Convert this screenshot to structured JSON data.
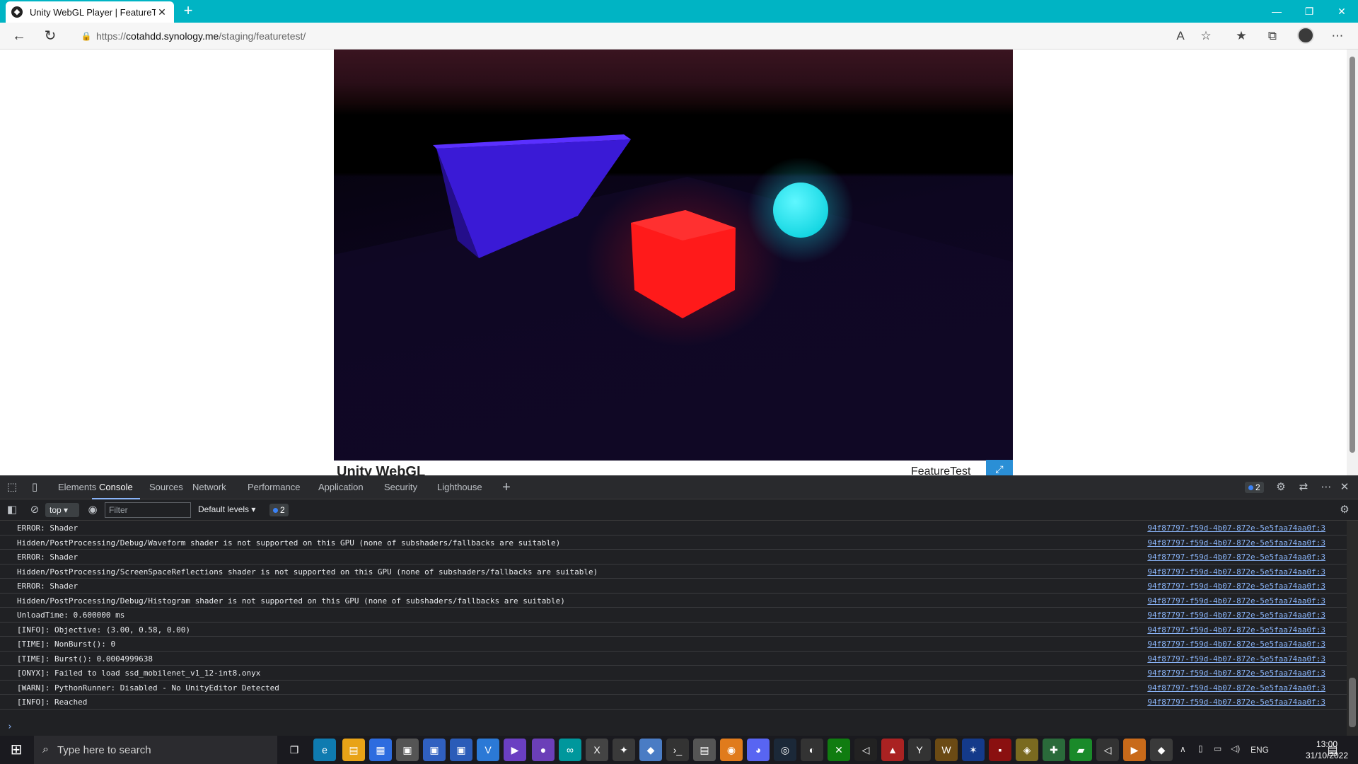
{
  "browser": {
    "tab_title": "Unity WebGL Player | FeatureTest",
    "url_scheme": "https://",
    "url_host": "cotahdd.synology.me",
    "url_path": "/staging/featuretest/"
  },
  "page": {
    "unity_logo": "Unity WebGL",
    "project_title": "FeatureTest"
  },
  "devtools": {
    "tabs": [
      "Elements",
      "Console",
      "Sources",
      "Network",
      "Performance",
      "Application",
      "Security",
      "Lighthouse"
    ],
    "active_tab": "Console",
    "issues_count": "2",
    "context": "top",
    "filter_placeholder": "Filter",
    "levels": "Default levels",
    "messages_count": "2",
    "log": [
      {
        "message": "ERROR: Shader",
        "source": "94f87797-f59d-4b07-872e-5e5faa74aa0f:3"
      },
      {
        "message": "Hidden/PostProcessing/Debug/Waveform shader is not supported on this GPU (none of subshaders/fallbacks are suitable)",
        "source": "94f87797-f59d-4b07-872e-5e5faa74aa0f:3"
      },
      {
        "message": "ERROR: Shader",
        "source": "94f87797-f59d-4b07-872e-5e5faa74aa0f:3"
      },
      {
        "message": "Hidden/PostProcessing/ScreenSpaceReflections shader is not supported on this GPU (none of subshaders/fallbacks are suitable)",
        "source": "94f87797-f59d-4b07-872e-5e5faa74aa0f:3"
      },
      {
        "message": "ERROR: Shader",
        "source": "94f87797-f59d-4b07-872e-5e5faa74aa0f:3"
      },
      {
        "message": "Hidden/PostProcessing/Debug/Histogram shader is not supported on this GPU (none of subshaders/fallbacks are suitable)",
        "source": "94f87797-f59d-4b07-872e-5e5faa74aa0f:3"
      },
      {
        "message": "UnloadTime: 0.600000 ms",
        "source": "94f87797-f59d-4b07-872e-5e5faa74aa0f:3"
      },
      {
        "message": "[INFO]: Objective: (3.00, 0.58, 0.00)",
        "source": "94f87797-f59d-4b07-872e-5e5faa74aa0f:3"
      },
      {
        "message": "[TIME]: NonBurst(): 0",
        "source": "94f87797-f59d-4b07-872e-5e5faa74aa0f:3"
      },
      {
        "message": "[TIME]: Burst(): 0.0004999638",
        "source": "94f87797-f59d-4b07-872e-5e5faa74aa0f:3"
      },
      {
        "message": "[ONYX]: Failed to load ssd_mobilenet_v1_12-int8.onyx",
        "source": "94f87797-f59d-4b07-872e-5e5faa74aa0f:3"
      },
      {
        "message": "[WARN]: PythonRunner: Disabled - No UnityEditor Detected",
        "source": "94f87797-f59d-4b07-872e-5e5faa74aa0f:3"
      },
      {
        "message": "[INFO]: Reached",
        "source": "94f87797-f59d-4b07-872e-5e5faa74aa0f:3"
      }
    ]
  },
  "taskbar": {
    "search_placeholder": "Type here to search",
    "language": "ENG",
    "time": "13:00",
    "date": "31/10/2022"
  },
  "colors": {
    "titlebar": "#00b4c4",
    "cube": "#ff1a1a",
    "sphere": "#1ee8f0",
    "wall": "#3a1ad6",
    "devtools_bg": "#202124",
    "link": "#8ab4f8"
  }
}
